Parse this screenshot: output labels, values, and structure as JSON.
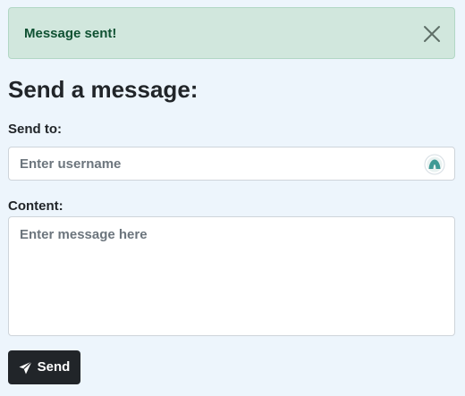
{
  "alert": {
    "message": "Message sent!",
    "close_icon": "close-icon",
    "background_color": "#d1e7dd",
    "text_color": "#0f5132"
  },
  "form": {
    "title": "Send a message:",
    "send_to_label": "Send to:",
    "username_placeholder": "Enter username",
    "username_value": "",
    "content_label": "Content:",
    "content_placeholder": "Enter message here",
    "content_value": "",
    "autofill_icon": "password-manager-icon"
  },
  "send_button": {
    "label": "Send",
    "icon": "paper-plane-icon",
    "background_color": "#212529"
  },
  "page": {
    "background_color": "#edf5fc"
  }
}
